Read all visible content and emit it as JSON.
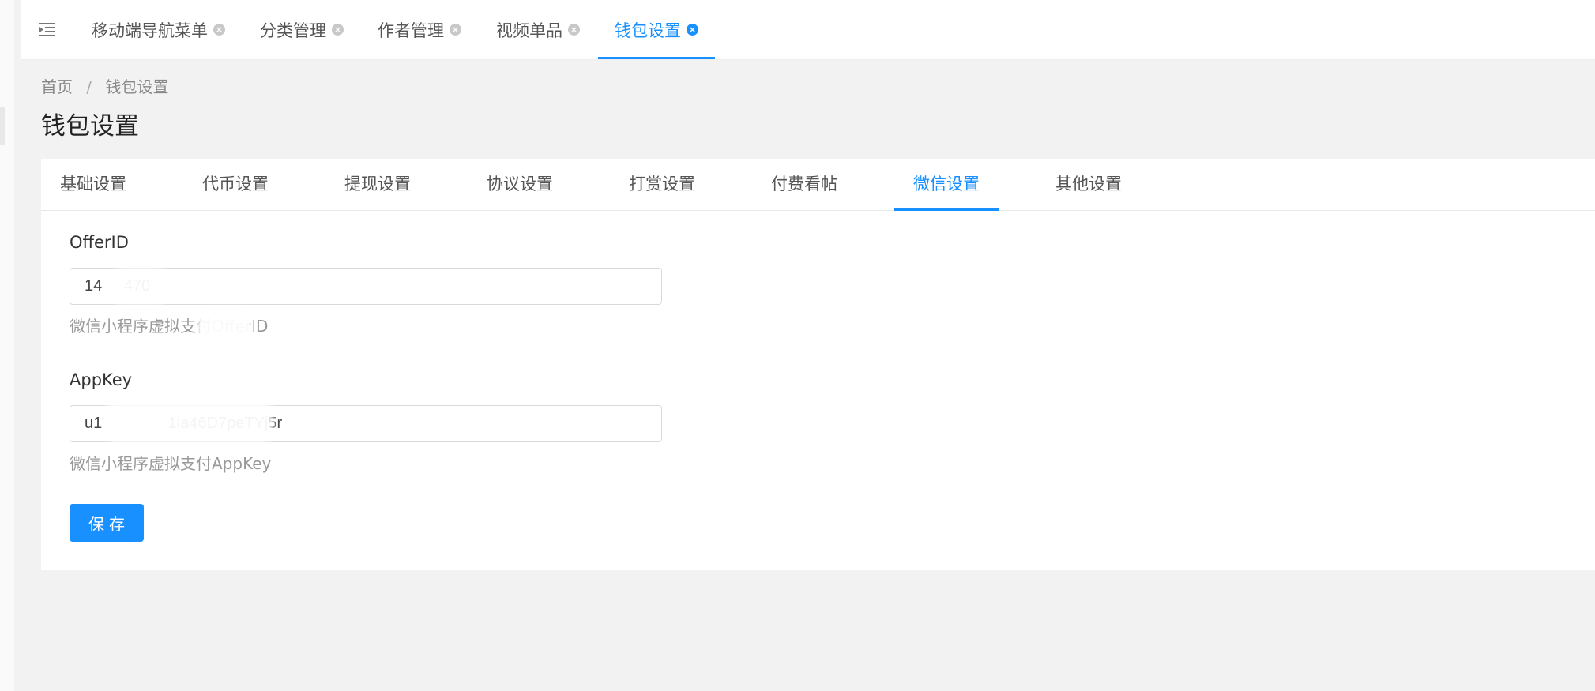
{
  "page_tabs": [
    {
      "label": "移动端导航菜单"
    },
    {
      "label": "分类管理"
    },
    {
      "label": "作者管理"
    },
    {
      "label": "视频单品"
    },
    {
      "label": "钱包设置",
      "active": true
    }
  ],
  "breadcrumb": {
    "home": "首页",
    "separator": "/",
    "current": "钱包设置"
  },
  "title": "钱包设置",
  "settings_tabs": [
    {
      "label": "基础设置"
    },
    {
      "label": "代币设置"
    },
    {
      "label": "提现设置"
    },
    {
      "label": "协议设置"
    },
    {
      "label": "打赏设置"
    },
    {
      "label": "付费看帖"
    },
    {
      "label": "微信设置",
      "active": true
    },
    {
      "label": "其他设置"
    }
  ],
  "form": {
    "offer_id": {
      "label": "OfferID",
      "value": "14     470",
      "help": "微信小程序虚拟支付OfferID"
    },
    "app_key": {
      "label": "AppKey",
      "value": "u1               1ia46D7peTYj5r",
      "help": "微信小程序虚拟支付AppKey"
    },
    "save_label": "保存"
  },
  "colors": {
    "accent": "#1890ff",
    "page_bg": "#f2f2f2",
    "card_bg": "#ffffff"
  },
  "icons": {
    "fold": "menu-fold-icon",
    "close": "close-circle-icon"
  }
}
